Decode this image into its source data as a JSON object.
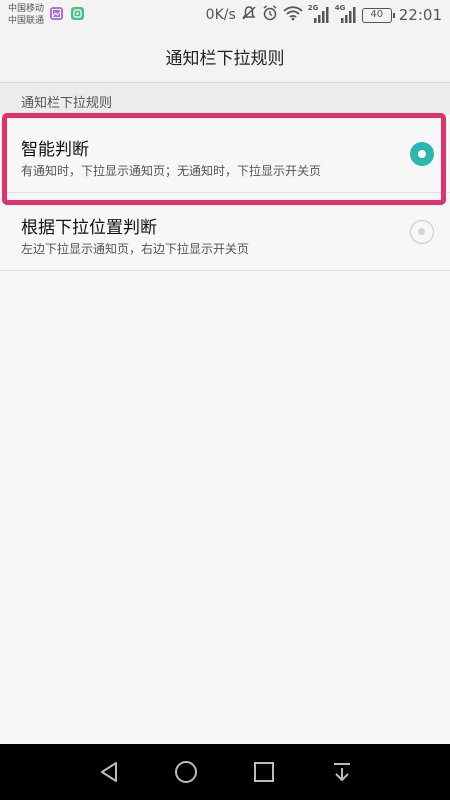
{
  "statusbar": {
    "carrier1": "中国移动",
    "carrier2": "中国联通",
    "netspeed": "0K/s",
    "signal_2g": "2G",
    "signal_4g": "4G",
    "battery": "40",
    "time": "22:01",
    "icons": [
      "gallery-notification-icon",
      "app-notification-icon",
      "mute-icon",
      "alarm-icon",
      "wifi-icon",
      "signal-2g-icon",
      "signal-4g-icon",
      "battery-icon"
    ]
  },
  "header": {
    "title": "通知栏下拉规则"
  },
  "section": {
    "title": "通知栏下拉规则"
  },
  "options": [
    {
      "title": "智能判断",
      "description": "有通知时，下拉显示通知页；无通知时，下拉显示开关页",
      "selected": true
    },
    {
      "title": "根据下拉位置判断",
      "description": "左边下拉显示通知页，右边下拉显示开关页",
      "selected": false
    }
  ],
  "navbar": {
    "icons": [
      "back-icon",
      "home-icon",
      "recent-apps-icon",
      "notification-pulldown-icon"
    ]
  },
  "colors": {
    "accent": "#2bb6b0",
    "highlight": "#e0336e",
    "background": "#f7f7f7"
  }
}
